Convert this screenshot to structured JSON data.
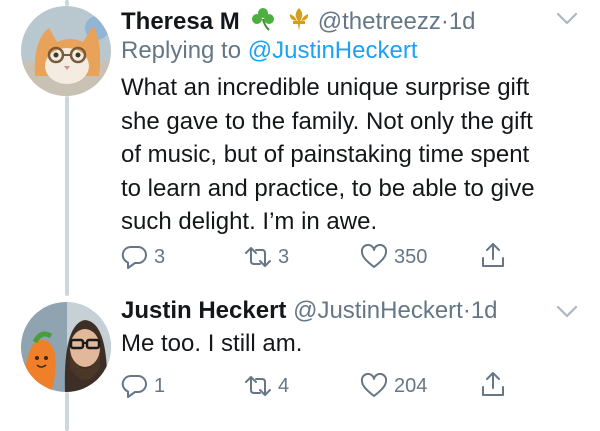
{
  "tweets": [
    {
      "display_name": "Theresa M",
      "badges": [
        "shamrock-emoji",
        "fleur-de-lis-emoji"
      ],
      "handle": "@thetreezz",
      "separator": "·",
      "time": "1d",
      "replying_prefix": "Replying to",
      "replying_to": "@JustinHeckert",
      "lines": [
        "What an incredible unique surprise gift",
        "she gave to the family. Not only the gift",
        "of music, but of painstaking time spent",
        "to learn and practice, to be able to give",
        "such delight. I’m in awe."
      ],
      "replies": "3",
      "retweets": "3",
      "likes": "350"
    },
    {
      "display_name": "Justin Heckert",
      "handle": "@JustinHeckert",
      "separator": "·",
      "time": "1d",
      "lines": [
        "Me too. I still am."
      ],
      "replies": "1",
      "retweets": "4",
      "likes": "204"
    }
  ],
  "colors": {
    "text": "#14171a",
    "secondary": "#657786",
    "link": "#1da1f2",
    "thread_line": "#ccd6dd"
  }
}
